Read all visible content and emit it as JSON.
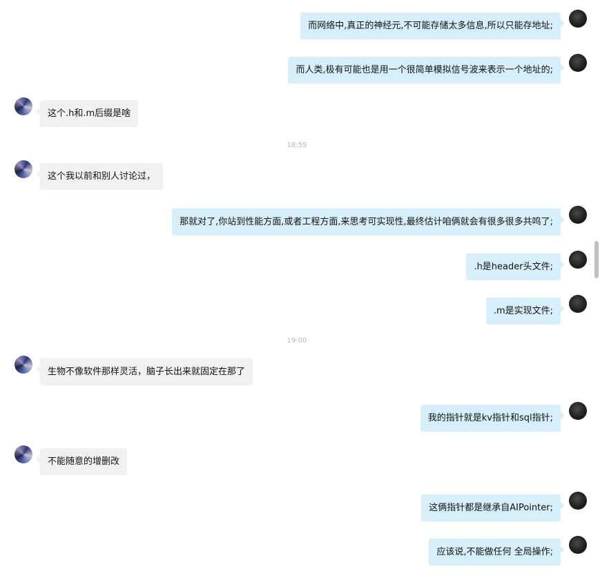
{
  "messages": [
    {
      "type": "msg",
      "side": "self",
      "text": "而网络中,真正的神经元,不可能存储太多信息,所以只能存地址;"
    },
    {
      "type": "msg",
      "side": "self",
      "text": "而人类,极有可能也是用一个很简单模拟信号波来表示一个地址的;"
    },
    {
      "type": "msg",
      "side": "other",
      "text": "这个.h和.m后缀是啥"
    },
    {
      "type": "time",
      "text": "18:59"
    },
    {
      "type": "msg",
      "side": "other",
      "text": "这个我以前和别人讨论过，"
    },
    {
      "type": "msg",
      "side": "self",
      "text": "那就对了,你站到性能方面,或者工程方面,来思考可实现性,最终估计咱俩就会有很多很多共鸣了;"
    },
    {
      "type": "msg",
      "side": "self",
      "text": ".h是header头文件;"
    },
    {
      "type": "msg",
      "side": "self",
      "text": ".m是实现文件;"
    },
    {
      "type": "time",
      "text": "19:00"
    },
    {
      "type": "msg",
      "side": "other",
      "text": "生物不像软件那样灵活，脑子长出来就固定在那了"
    },
    {
      "type": "msg",
      "side": "self",
      "text": "我的指针就是kv指针和sql指针;"
    },
    {
      "type": "msg",
      "side": "other",
      "text": "不能随意的增删改"
    },
    {
      "type": "msg",
      "side": "self",
      "text": "这俩指针都是继承自AIPointer;"
    },
    {
      "type": "msg",
      "side": "self",
      "text": "应该说,不能做任何 全局操作;"
    }
  ]
}
